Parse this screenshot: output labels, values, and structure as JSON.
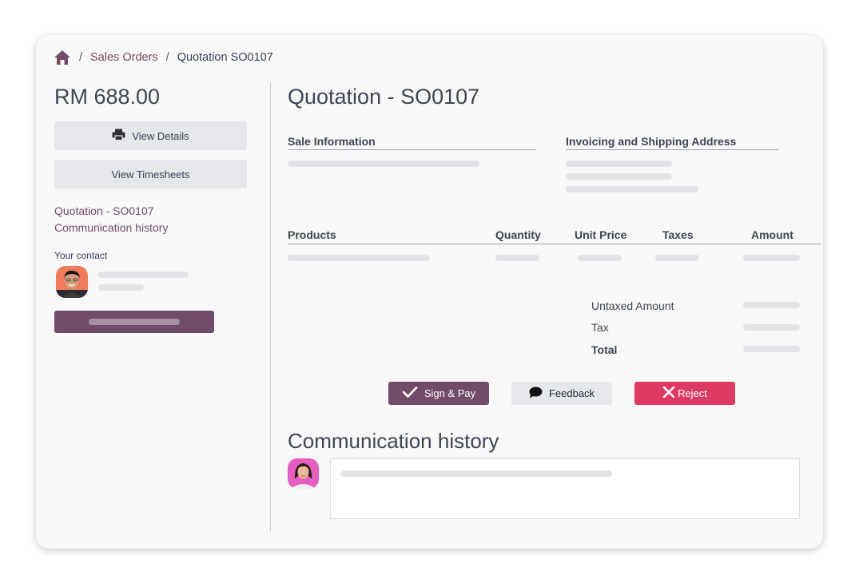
{
  "breadcrumb": {
    "home_icon": "home-icon",
    "separator": "/",
    "items": [
      "Sales Orders",
      "Quotation SO0107"
    ]
  },
  "sidebar": {
    "price": "RM 688.00",
    "view_details_label": "View Details",
    "view_details_icon": "printer-icon",
    "view_timesheets_label": "View Timesheets",
    "links": [
      "Quotation - SO0107",
      "Communication history"
    ],
    "contact_label": "Your contact"
  },
  "main": {
    "title": "Quotation - SO0107",
    "sale_information": "Sale Information",
    "invoicing_address": "Invoicing and Shipping Address",
    "table": {
      "columns": [
        "Products",
        "Quantity",
        "Unit Price",
        "Taxes",
        "Amount"
      ]
    },
    "totals": {
      "untaxed": "Untaxed Amount",
      "tax": "Tax",
      "total": "Total"
    },
    "actions": {
      "sign_pay": "Sign & Pay",
      "feedback": "Feedback",
      "reject": "Reject"
    },
    "communication_title": "Communication history"
  },
  "colors": {
    "brand": "#714b67",
    "danger": "#dc3a62",
    "card_bg": "#f8f8f9",
    "skeleton": "#e3e4e8"
  }
}
